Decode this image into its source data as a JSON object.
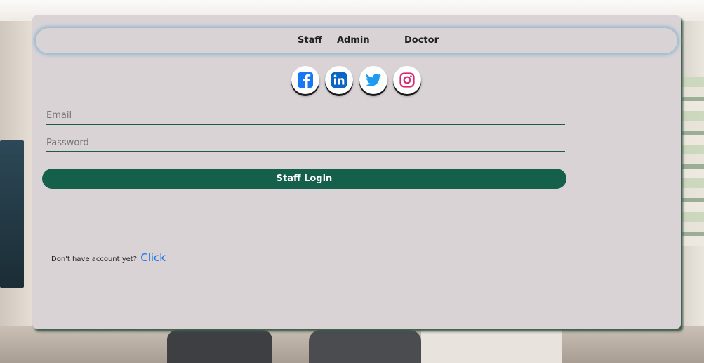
{
  "nav": {
    "staff": "Staff",
    "admin": "Admin",
    "doctor": "Doctor"
  },
  "social": [
    {
      "icon": "facebook-icon",
      "color": "#1877f2"
    },
    {
      "icon": "linkedin-icon",
      "color": "#0a66c2"
    },
    {
      "icon": "twitter-icon",
      "color": "#1d9bf0"
    },
    {
      "icon": "instagram-icon",
      "color": "#d62976"
    }
  ],
  "form": {
    "email_placeholder": "Email",
    "password_placeholder": "Password",
    "login_label": "Staff Login"
  },
  "signup": {
    "text": "Don't have account yet?",
    "link_label": "Click"
  },
  "colors": {
    "card_bg": "#d9d3d6",
    "primary": "#14604a",
    "link": "#1a73e8"
  }
}
